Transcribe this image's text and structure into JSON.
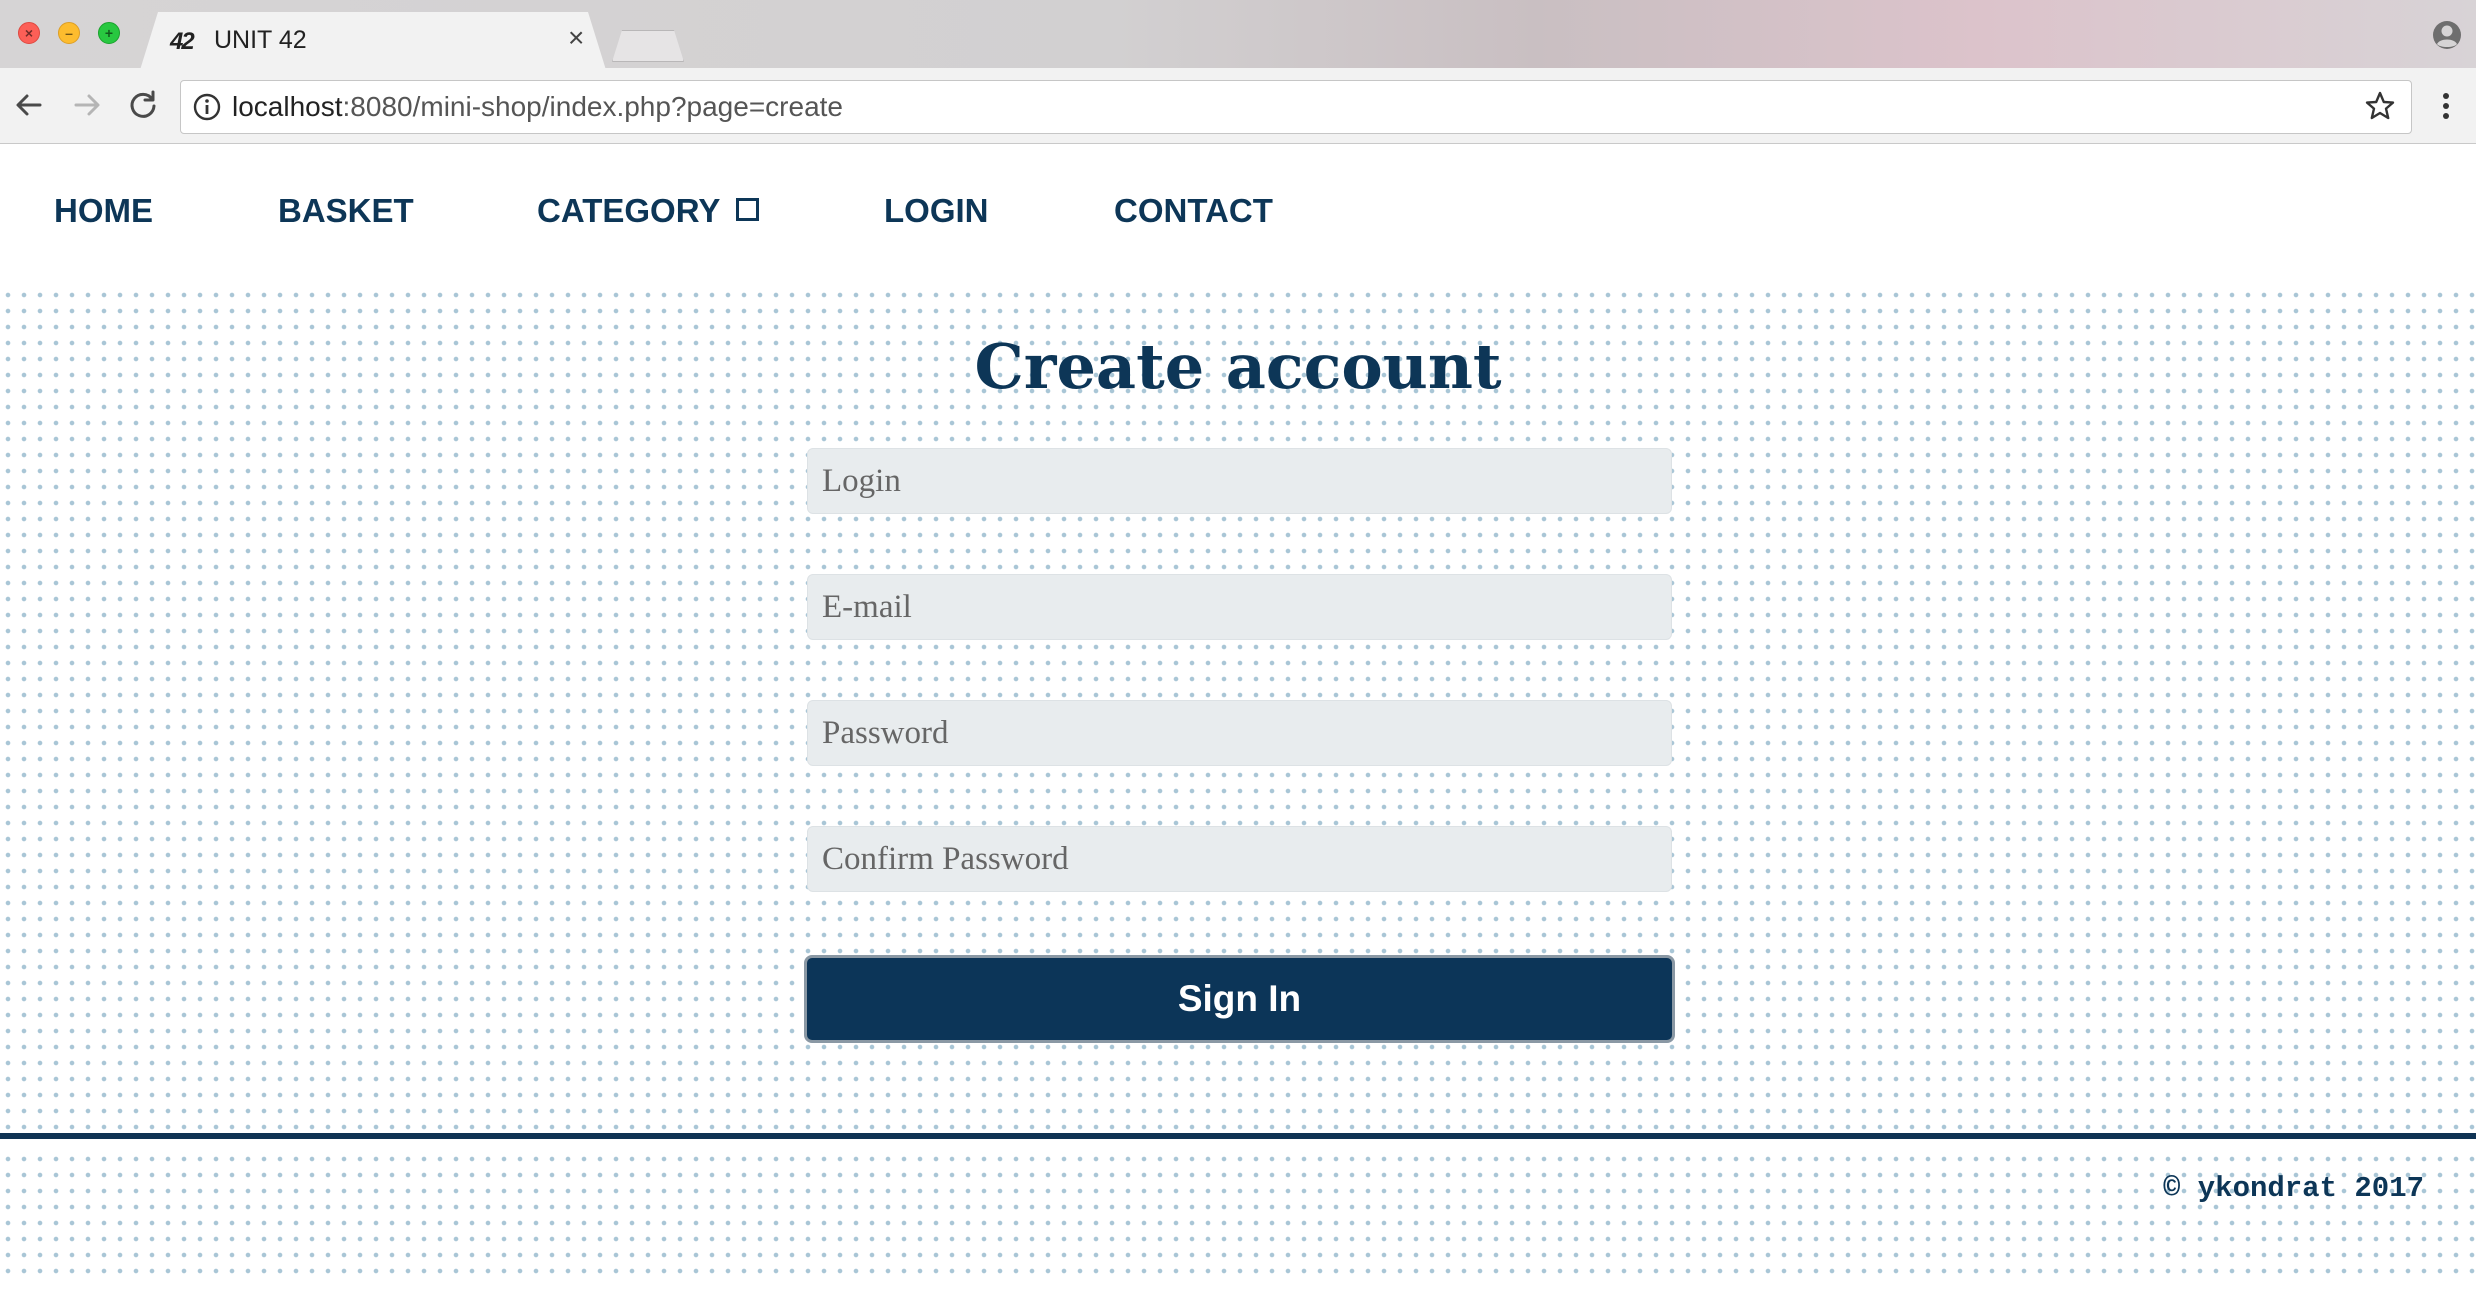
{
  "browser": {
    "tab": {
      "favicon": "42",
      "title": "UNIT 42",
      "close": "×"
    },
    "url": {
      "host": "localhost",
      "rest": ":8080/mini-shop/index.php?page=create"
    }
  },
  "nav": {
    "items": [
      {
        "label": "HOME"
      },
      {
        "label": "BASKET"
      },
      {
        "label": "CATEGORY"
      },
      {
        "label": "LOGIN"
      },
      {
        "label": "CONTACT"
      }
    ]
  },
  "form": {
    "heading": "Create account",
    "login_placeholder": "Login",
    "email_placeholder": "E-mail",
    "password_placeholder": "Password",
    "confirm_placeholder": "Confirm Password",
    "submit_label": "Sign In"
  },
  "footer": {
    "copyright": "© ykondrat 2017"
  },
  "colors": {
    "brand_navy": "#0d3657",
    "field_bg": "#e8ecee",
    "dot": "#a9c6d6"
  }
}
